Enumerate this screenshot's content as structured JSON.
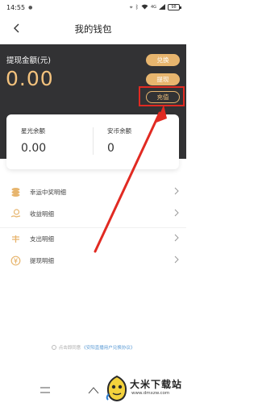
{
  "status_bar": {
    "time": "14:55",
    "battery": "98",
    "signal": "4G"
  },
  "nav": {
    "title": "我的钱包"
  },
  "header": {
    "withdraw_label": "提现金额(元)",
    "withdraw_amount": "0.00",
    "buttons": {
      "exchange": "兑换",
      "withdraw": "提现",
      "recharge": "充值"
    },
    "accent_color": "#e7b56e",
    "background_color": "#323234"
  },
  "balances": {
    "starlight": {
      "label": "星光余额",
      "value": "0.00"
    },
    "anbi": {
      "label": "安币余额",
      "value": "0"
    }
  },
  "menu": [
    {
      "label": "幸运中奖明细",
      "icon": "coins-icon"
    },
    {
      "label": "收益明细",
      "icon": "hand-coin-icon"
    },
    {
      "label": "支出明细",
      "icon": "expense-icon"
    },
    {
      "label": "提现明细",
      "icon": "yen-coin-icon"
    }
  ],
  "agreement": {
    "prefix": "点击即同意",
    "link": "《安阳直播用户兑换协议》"
  },
  "watermark": {
    "title": "大米下载站",
    "url": "www.dmxzw.com"
  },
  "highlight_color": "#e12a22"
}
